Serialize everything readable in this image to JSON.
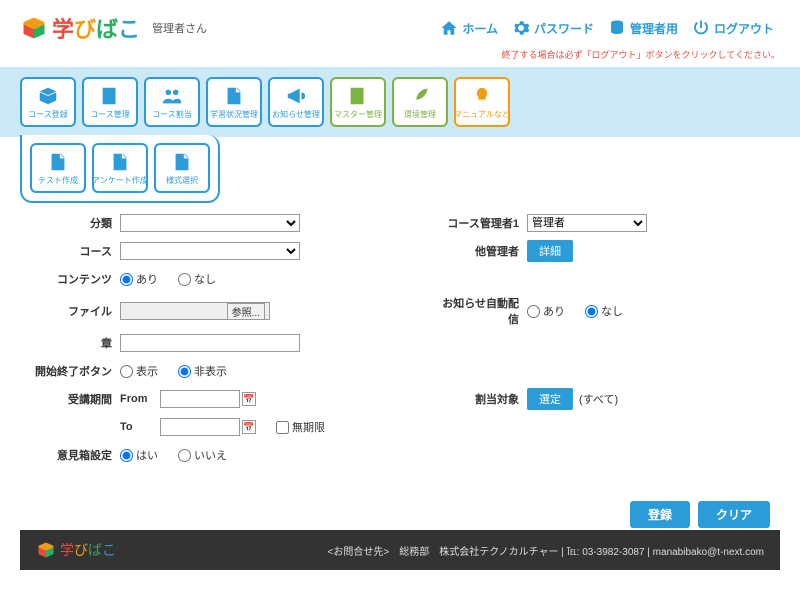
{
  "header": {
    "brand_chars": [
      "学",
      "び",
      "ば",
      "こ"
    ],
    "user": "管理者さん",
    "links": {
      "home": "ホーム",
      "password": "パスワード",
      "admin": "管理者用",
      "logout": "ログアウト"
    },
    "notice": "終了する場合は必ず「ログアウト」ボタンをクリックしてください。"
  },
  "nav": [
    {
      "label": "コース登録",
      "color": "blue",
      "icon": "box"
    },
    {
      "label": "コース管理",
      "color": "blue",
      "icon": "book"
    },
    {
      "label": "コース割当",
      "color": "blue",
      "icon": "people"
    },
    {
      "label": "学習状況管理",
      "color": "blue",
      "icon": "doc"
    },
    {
      "label": "お知らせ管理",
      "color": "blue",
      "icon": "megaphone"
    },
    {
      "label": "マスター管理",
      "color": "green",
      "icon": "book"
    },
    {
      "label": "環境管理",
      "color": "green",
      "icon": "feather"
    },
    {
      "label": "マニュアルなど",
      "color": "orange",
      "icon": "bulb"
    }
  ],
  "subnav": [
    {
      "label": "テスト作成",
      "icon": "doc"
    },
    {
      "label": "アンケート作成",
      "icon": "doc"
    },
    {
      "label": "様式選択",
      "icon": "doc"
    }
  ],
  "form": {
    "labels": {
      "category": "分類",
      "course": "コース",
      "contents": "コンテンツ",
      "file": "ファイル",
      "chapter": "章",
      "endButton": "開始終了ボタン",
      "period": "受講期間",
      "from": "From",
      "to": "To",
      "reanswer": "意見箱設定",
      "instructor1": "コース管理者1",
      "otherInstr": "他管理者",
      "autoNotify": "お知らせ自動配信",
      "target": "割当対象"
    },
    "options": {
      "ari": "あり",
      "nashi": "なし",
      "show": "表示",
      "hide": "非表示",
      "yes": "はい",
      "no": "いいえ",
      "unlimited": "無期限",
      "all": "(すべて)",
      "instructor_value": "管理者"
    },
    "buttons": {
      "fileBrowse": "参照...",
      "detail": "詳細",
      "select": "選定",
      "submit": "登録",
      "clear": "クリア"
    }
  },
  "footer": {
    "contact_label": "<お問合せ先>",
    "dept": "総務部",
    "company": "株式会社テクノカルチャー",
    "tel": "℡: 03-3982-3087",
    "email": "manabibako@t-next.com"
  }
}
